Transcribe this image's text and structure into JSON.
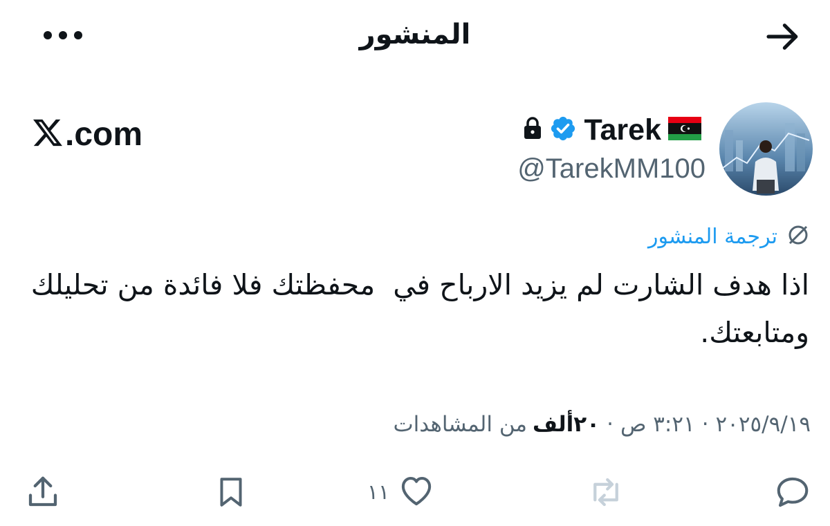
{
  "header": {
    "title": "المنشور",
    "back_icon": "arrow-right-icon",
    "more_icon": "more-horizontal-icon"
  },
  "author": {
    "display_name": "Tarek",
    "handle": "@TarekMM100",
    "flag_icon": "libya-flag-icon",
    "verified_icon": "verified-badge-icon",
    "protected_icon": "lock-icon"
  },
  "source_logo": {
    "x_glyph": "𝕏",
    "text": ".com"
  },
  "translate": {
    "label": "ترجمة المنشور",
    "icon": "translate-icon"
  },
  "tweet": {
    "text": "اذا هدف الشارت لم يزيد الارباح في  محفظتك فلا فائدة من تحليلك ومتابعتك."
  },
  "meta": {
    "date": "٢٠٢٥/٩/١٩",
    "time": "٣:٢١ ص",
    "separator": "·",
    "views_count": "٢٠ألف",
    "views_label": "من المشاهدات"
  },
  "actions": {
    "like_count": "١١"
  },
  "colors": {
    "text": "#0f1419",
    "secondary": "#536471",
    "accent": "#1d9bf0",
    "verified": "#1d9bf0"
  }
}
